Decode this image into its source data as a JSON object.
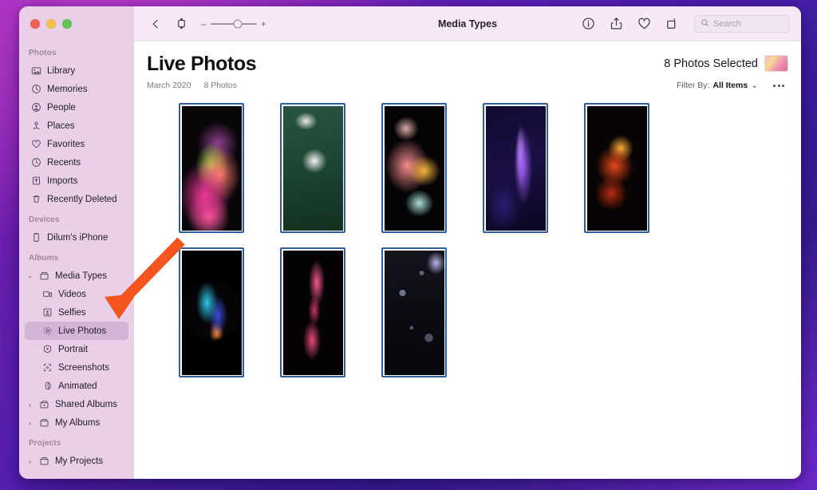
{
  "window": {
    "title": "Media Types"
  },
  "traffic_lights": {
    "close": "close",
    "minimize": "minimize",
    "zoom": "zoom"
  },
  "toolbar": {
    "back_icon": "chevron-left-icon",
    "sidebar_icon": "sidebar-toggle-icon",
    "zoom_out_label": "–",
    "zoom_in_label": "+",
    "zoom_value": 60,
    "info_icon": "info-icon",
    "share_icon": "share-icon",
    "favorite_icon": "heart-icon",
    "rotate_icon": "rotate-icon",
    "search": {
      "placeholder": "Search",
      "value": ""
    }
  },
  "sidebar": {
    "groups": [
      {
        "title": "Photos",
        "items": [
          {
            "label": "Library",
            "icon": "library-icon"
          },
          {
            "label": "Memories",
            "icon": "memories-icon"
          },
          {
            "label": "People",
            "icon": "people-icon"
          },
          {
            "label": "Places",
            "icon": "places-icon"
          },
          {
            "label": "Favorites",
            "icon": "heart-icon"
          },
          {
            "label": "Recents",
            "icon": "clock-icon"
          },
          {
            "label": "Imports",
            "icon": "import-icon"
          },
          {
            "label": "Recently Deleted",
            "icon": "trash-icon"
          }
        ]
      },
      {
        "title": "Devices",
        "items": [
          {
            "label": "Dilum's iPhone",
            "icon": "iphone-icon"
          }
        ]
      },
      {
        "title": "Albums",
        "items": [
          {
            "label": "Media Types",
            "icon": "album-icon",
            "twisty": "⌄",
            "expanded": true
          },
          {
            "label": "Videos",
            "icon": "video-icon",
            "indent": true
          },
          {
            "label": "Selfies",
            "icon": "selfie-icon",
            "indent": true
          },
          {
            "label": "Live Photos",
            "icon": "live-photo-icon",
            "indent": true,
            "selected": true
          },
          {
            "label": "Portrait",
            "icon": "portrait-icon",
            "indent": true
          },
          {
            "label": "Screenshots",
            "icon": "screenshot-icon",
            "indent": true
          },
          {
            "label": "Animated",
            "icon": "animated-icon",
            "indent": true
          },
          {
            "label": "Shared Albums",
            "icon": "shared-album-icon",
            "twisty": "›"
          },
          {
            "label": "My Albums",
            "icon": "album-icon",
            "twisty": "›"
          }
        ]
      },
      {
        "title": "Projects",
        "items": [
          {
            "label": "My Projects",
            "icon": "album-icon",
            "twisty": "›"
          }
        ]
      }
    ]
  },
  "content": {
    "page_title": "Live Photos",
    "date": "March 2020",
    "count": "8 Photos",
    "selection_text": "8 Photos Selected",
    "filter_prefix": "Filter By:",
    "filter_value": "All Items",
    "filter_chevron": "⌄",
    "more_icon": "more-options-icon",
    "photos": [
      {
        "name": "colorful-powder-explosion",
        "art": "p1",
        "selected": true
      },
      {
        "name": "aerial-surfer-green-water",
        "art": "p2",
        "selected": true
      },
      {
        "name": "pink-orange-ink-cloud",
        "art": "p3",
        "selected": true
      },
      {
        "name": "purple-particle-streak",
        "art": "p4",
        "selected": true
      },
      {
        "name": "red-fire-streaks",
        "art": "p5",
        "selected": true
      },
      {
        "name": "blue-abstract-sphere",
        "art": "p6",
        "selected": true
      },
      {
        "name": "pink-silk-ribbon",
        "art": "p7",
        "selected": true
      },
      {
        "name": "dark-water-bubbles",
        "art": "p8",
        "selected": true
      }
    ]
  },
  "annotation": {
    "arrow_color": "#f4541d",
    "points_at": "Live Photos"
  }
}
